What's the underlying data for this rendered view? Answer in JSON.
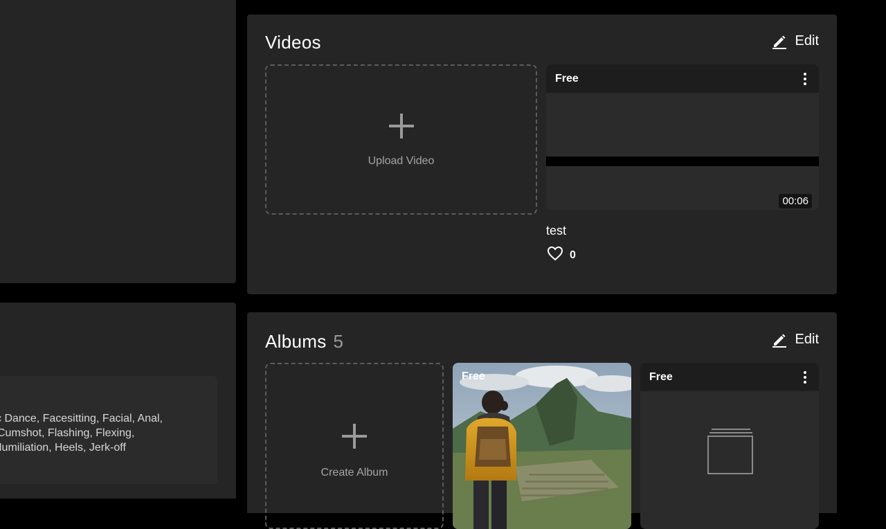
{
  "tags_text": [
    "tic Dance, Facesitting, Facial, Anal,",
    " Cumshot, Flashing, Flexing,",
    "Humiliation, Heels, Jerk-off"
  ],
  "videos": {
    "title": "Videos",
    "edit_label": "Edit",
    "upload_label": "Upload Video",
    "items": [
      {
        "badge": "Free",
        "duration": "00:06",
        "title": "test",
        "likes": "0"
      }
    ]
  },
  "albums": {
    "title": "Albums",
    "count": "5",
    "edit_label": "Edit",
    "create_label": "Create Album",
    "items": [
      {
        "badge": "Free"
      },
      {
        "badge": "Free"
      }
    ]
  },
  "colors": {
    "background": "#000000",
    "panel": "#252525",
    "card_header": "#1d1d1d",
    "dashed_border": "#5c5c5c",
    "muted_text": "#a5a5a5"
  }
}
